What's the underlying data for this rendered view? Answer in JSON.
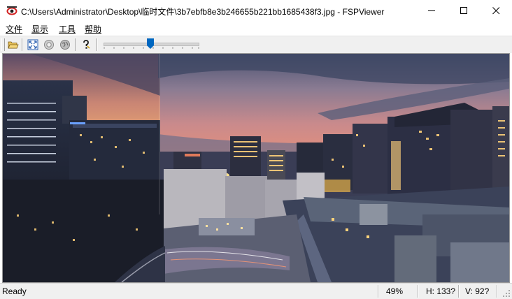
{
  "window": {
    "title": "C:\\Users\\Administrator\\Desktop\\临时文件\\3b7ebfb8e3b246655b221bb1685438f3.jpg - FSPViewer"
  },
  "menu": [
    {
      "label": "文件",
      "mnemonic": "F"
    },
    {
      "label": "显示",
      "mnemonic": "V"
    },
    {
      "label": "工具",
      "mnemonic": "T"
    },
    {
      "label": "帮助",
      "mnemonic": "H"
    }
  ],
  "toolbar": {
    "icons": [
      "open-folder-icon",
      "fullscreen-icon",
      "sphere-icon",
      "globe-icon",
      "help-icon"
    ],
    "zoom_slider_fraction": 0.46
  },
  "status": {
    "text": "Ready",
    "zoom": "49%",
    "h": "H: 133?",
    "v": "V: 92?"
  },
  "colors": {
    "accent": "#0067c0",
    "sky_left": "#f3a86c",
    "sky_right": "#e8866e",
    "night": "#2a3250"
  }
}
